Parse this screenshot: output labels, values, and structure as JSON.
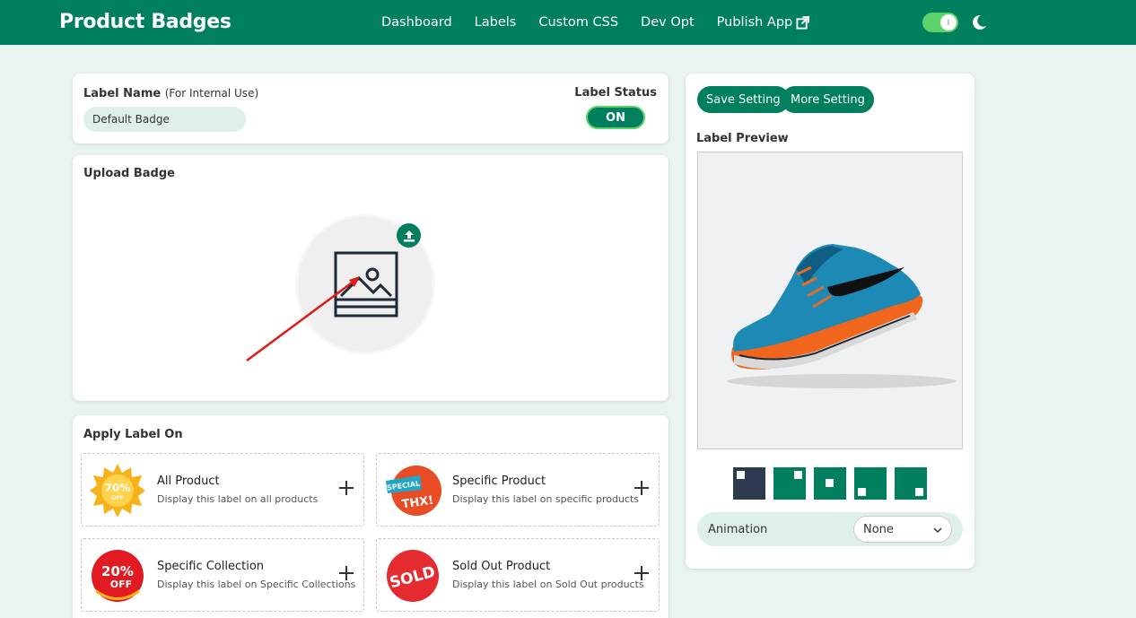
{
  "header": {
    "brand": "Product Badges",
    "nav": [
      "Dashboard",
      "Labels",
      "Custom CSS",
      "Dev Opt",
      "Publish App"
    ],
    "toggle_on": true,
    "toggle_knob": "I"
  },
  "label_name": {
    "label": "Label Name",
    "hint": "(For Internal Use)",
    "value": "Default Badge"
  },
  "label_status": {
    "label": "Label Status",
    "value": "ON"
  },
  "upload": {
    "title": "Upload Badge"
  },
  "apply": {
    "title": "Apply Label On",
    "options": [
      {
        "title": "All Product",
        "desc": "Display this label on all products",
        "badge_line1": "70%",
        "badge_line2": "OFF"
      },
      {
        "title": "Specific Product",
        "desc": "Display this label on specific products",
        "badge_line1": "SPECIAL",
        "badge_line2": "THX!"
      },
      {
        "title": "Specific Collection",
        "desc": "Display this label on Specific Collections",
        "badge_line1": "20%",
        "badge_line2": "OFF"
      },
      {
        "title": "Sold Out Product",
        "desc": "Display this label on Sold Out products",
        "badge_line1": "SOLD",
        "badge_line2": ""
      }
    ]
  },
  "right_panel": {
    "save_button": "Save Setting",
    "more_button": "More Setting",
    "preview_title": "Label Preview",
    "animation_label": "Animation",
    "animation_value": "None",
    "positions": [
      "top-left",
      "top-right",
      "center",
      "bottom-left",
      "bottom-right"
    ],
    "selected_position": "top-left"
  },
  "colors": {
    "brand": "#007f5f",
    "accent_light": "#dff0ea",
    "toggle": "#5cd36a",
    "arrow": "#e0191a"
  }
}
